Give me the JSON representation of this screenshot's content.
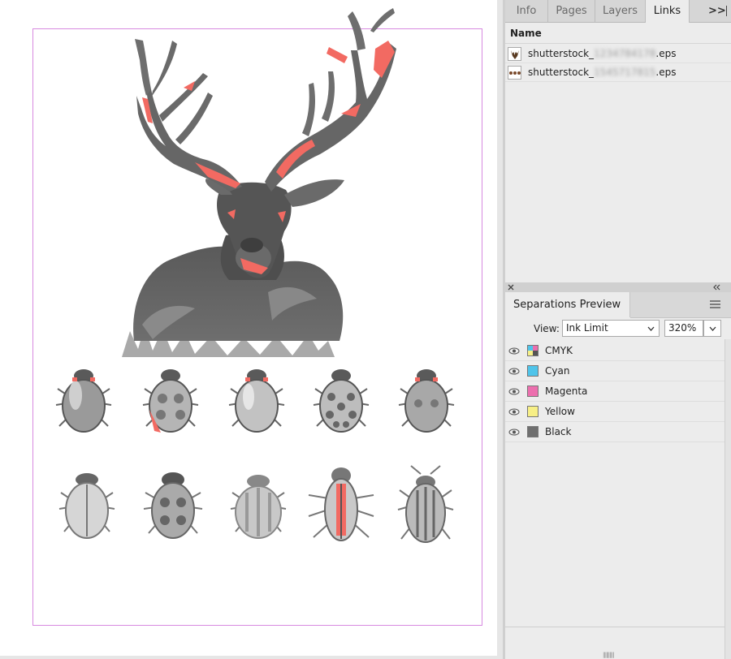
{
  "panel": {
    "tabs": [
      {
        "label": "Info"
      },
      {
        "label": "Pages"
      },
      {
        "label": "Layers"
      },
      {
        "label": "Links"
      }
    ],
    "overflow_label": ">>",
    "links": {
      "column_name": "Name",
      "rows": [
        {
          "prefix": "shutterstock_",
          "hidden": "1234784178",
          "ext": ".eps",
          "thumb": "deer"
        },
        {
          "prefix": "shutterstock_",
          "hidden": "1545717815",
          "ext": ".eps",
          "thumb": "beetles"
        }
      ]
    },
    "separations": {
      "title": "Separations Preview",
      "view_label": "View:",
      "view_value": "Ink Limit",
      "percent_value": "320%",
      "inks": [
        {
          "label": "CMYK",
          "color": "cmyk"
        },
        {
          "label": "Cyan",
          "color": "#4fc4ea"
        },
        {
          "label": "Magenta",
          "color": "#ec6fae"
        },
        {
          "label": "Yellow",
          "color": "#f7ef86"
        },
        {
          "label": "Black",
          "color": "#6f6f6f"
        }
      ]
    }
  },
  "colors": {
    "ink_limit_highlight": "#f26a62",
    "margin_guide": "#d78ae0"
  }
}
